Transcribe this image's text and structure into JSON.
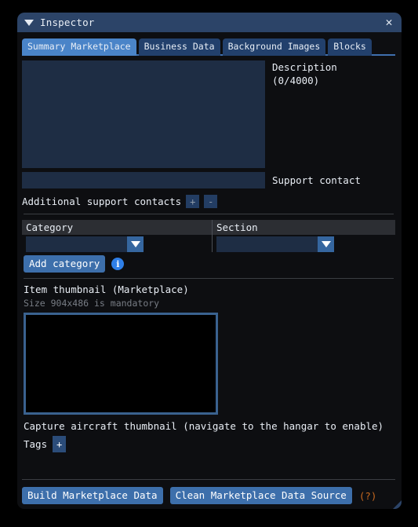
{
  "window": {
    "title": "Inspector",
    "collapse_icon": "triangle-down-icon",
    "close_icon": "close-icon"
  },
  "tabs": [
    {
      "label": "Summary Marketplace",
      "active": true
    },
    {
      "label": "Business Data",
      "active": false
    },
    {
      "label": "Background Images",
      "active": false
    },
    {
      "label": "Blocks",
      "active": false
    }
  ],
  "description": {
    "value": "",
    "label": "Description\n(0/4000)"
  },
  "support_contact": {
    "value": "",
    "label": "Support contact"
  },
  "additional_support_contacts": {
    "label": "Additional support contacts",
    "add_label": "+",
    "remove_label": "-"
  },
  "category_table": {
    "headers": [
      "Category",
      "Section"
    ],
    "category_value": "",
    "section_value": "",
    "dropdown_arrow_icon": "triangle-down-icon"
  },
  "add_category": {
    "label": "Add category",
    "info_icon": "info-icon",
    "info_glyph": "i"
  },
  "thumbnail": {
    "title": "Item thumbnail (Marketplace)",
    "subtitle": "Size 904x486 is mandatory"
  },
  "capture": {
    "label": "Capture aircraft thumbnail (navigate to the hangar to enable)"
  },
  "tags": {
    "label": "Tags",
    "add_label": "+"
  },
  "footer": {
    "build_label": "Build Marketplace Data",
    "clean_label": "Clean Marketplace Data Source",
    "help_label": "(?)"
  },
  "colors": {
    "titlebar": "#2c4468",
    "tab_active": "#4a84c8",
    "tab_inactive": "#22406c",
    "tab_underline": "#3f6fae",
    "field": "#1e2d44",
    "button_blue": "#3d6fab",
    "info_blue": "#2f7fe8",
    "help_orange": "#c8691f",
    "thumb_border": "#3a628f",
    "panel_bg": "#0d0e11"
  }
}
